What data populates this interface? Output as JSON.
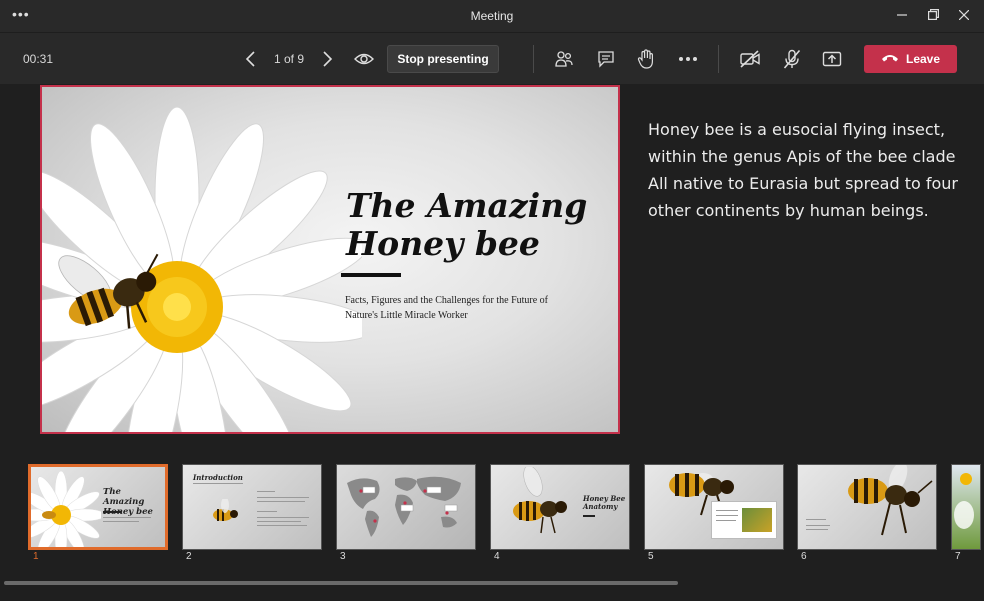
{
  "window": {
    "title": "Meeting"
  },
  "toolbar": {
    "timer": "00:31",
    "page_count": "1 of 9",
    "stop_presenting_label": "Stop presenting",
    "leave_label": "Leave"
  },
  "slide": {
    "title_line1": "The Amazing",
    "title_line2": "Honey bee",
    "subtitle_line1": "Facts, Figures and the Challenges for the Future of",
    "subtitle_line2": "Nature's Little Miracle Worker"
  },
  "notes": {
    "line1": "Honey bee is a eusocial flying insect,",
    "line2": "within the genus Apis of the bee clade",
    "line3": "All native to Eurasia but spread to four",
    "line4": "other continents by human beings."
  },
  "thumbnails": [
    {
      "number": "1",
      "title_line1": "The Amazing",
      "title_line2": "Honey bee",
      "active": true
    },
    {
      "number": "2",
      "title": "Introduction"
    },
    {
      "number": "3"
    },
    {
      "number": "4",
      "title_line1": "Honey Bee",
      "title_line2": "Anatomy"
    },
    {
      "number": "5"
    },
    {
      "number": "6"
    },
    {
      "number": "7"
    }
  ],
  "colors": {
    "leave": "#c4314b",
    "active_thumb": "#e06b2b",
    "background": "#1f1f1f"
  },
  "icons": [
    "more-icon",
    "minimize-icon",
    "restore-icon",
    "close-icon",
    "prev-slide-icon",
    "next-slide-icon",
    "eye-icon",
    "people-icon",
    "chat-icon",
    "raise-hand-icon",
    "more-actions-icon",
    "camera-off-icon",
    "mic-off-icon",
    "share-icon",
    "phone-icon"
  ]
}
